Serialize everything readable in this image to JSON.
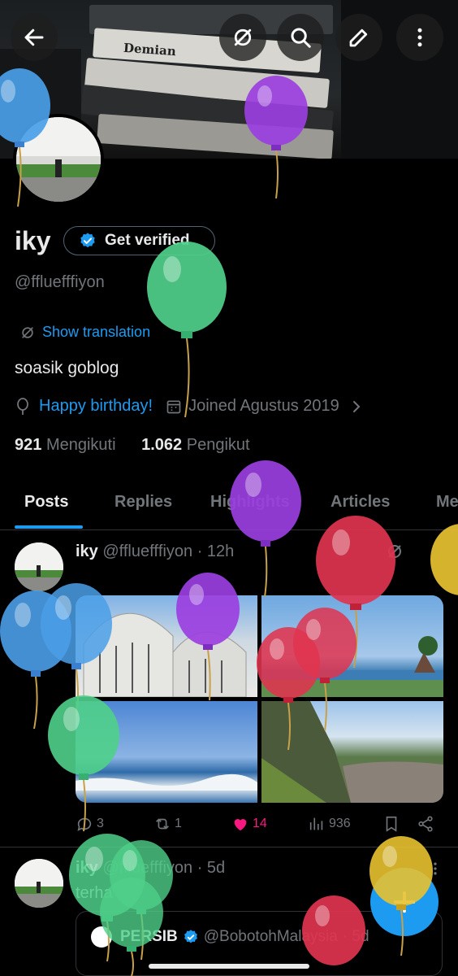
{
  "header": {
    "back_icon": "arrow-left-icon",
    "actions": [
      "translate-off-icon",
      "search-icon",
      "edit-icon",
      "more-vertical-icon"
    ]
  },
  "banner": {
    "book_titles": [
      "Demian"
    ]
  },
  "profile": {
    "name": "iky",
    "verify_label": "Get verified",
    "handle": "@fflueffﬁyon",
    "show_translation": "Show translation",
    "bio": "soasik goblog",
    "birthday": "Happy birthday!",
    "joined": "Joined Agustus 2019",
    "following_count": "921",
    "following_label": "Mengikuti",
    "followers_count": "1.062",
    "followers_label": "Pengikut"
  },
  "tabs": [
    "Posts",
    "Replies",
    "Highlights",
    "Articles",
    "Me"
  ],
  "active_tab": "Posts",
  "tweets": [
    {
      "name": "iky",
      "handle": "@fflueffﬁyon",
      "time": "· 12h",
      "replies": "3",
      "reposts": "1",
      "likes": "14",
      "views": "936"
    },
    {
      "name": "iky",
      "handle": "@fflueffﬁyon",
      "time": "· 5d",
      "text": "terha",
      "quote_name": "PERSIB",
      "quote_handle": "@BobotohMalaysia",
      "quote_time": "· 5d"
    }
  ],
  "colors": {
    "accent": "#1d9bf0",
    "like": "#f91880",
    "muted": "#71767b",
    "balloon_blue": "#4a9fe8",
    "balloon_purple": "#9b3fe0",
    "balloon_green": "#4fd08a",
    "balloon_red": "#e0344f",
    "balloon_yellow": "#e8c230"
  }
}
